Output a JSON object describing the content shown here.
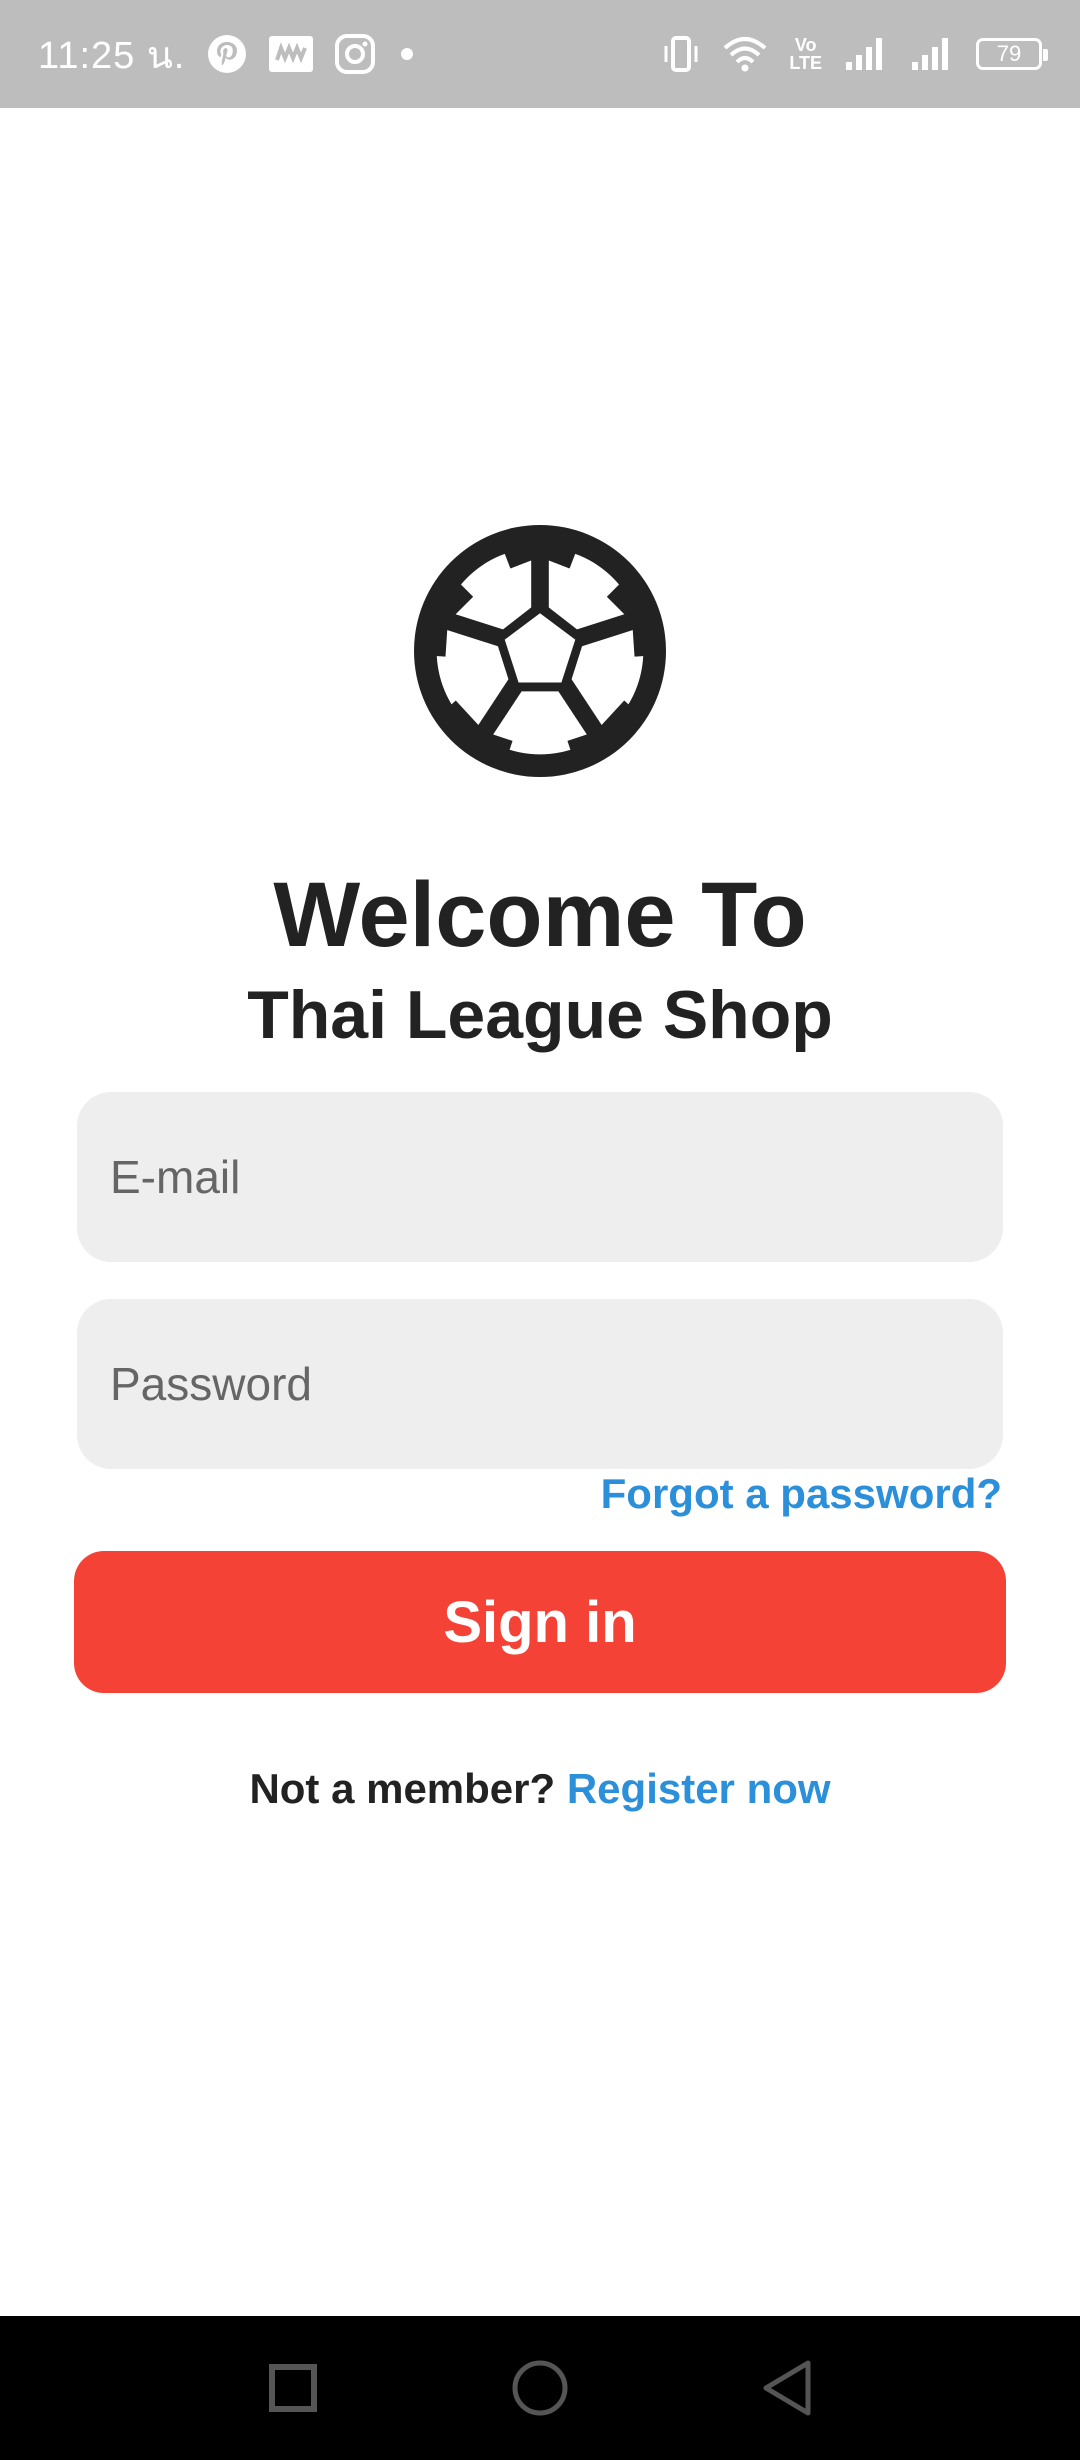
{
  "status_bar": {
    "time": "11:25 น.",
    "notification_icons": [
      "pinterest-icon",
      "news-icon",
      "instagram-icon",
      "dot-icon"
    ],
    "status_icons": [
      "vibrate-icon",
      "wifi-icon",
      "volte-icon",
      "signal-icon",
      "signal-icon",
      "battery-icon"
    ],
    "volte_label_top": "Vo",
    "volte_label_bottom": "LTE",
    "battery_level": "79"
  },
  "logo": {
    "icon": "soccer-ball-icon"
  },
  "welcome": {
    "title": "Welcome To",
    "subtitle": "Thai League Shop"
  },
  "form": {
    "email_placeholder": "E-mail",
    "email_value": "",
    "password_placeholder": "Password",
    "password_value": "",
    "forgot_password_label": "Forgot a password?",
    "sign_in_label": "Sign in"
  },
  "register": {
    "prompt": "Not a member?",
    "link_label": "Register now"
  },
  "nav_bar": {
    "buttons": [
      "recents-square-icon",
      "home-circle-icon",
      "back-triangle-icon"
    ]
  },
  "colors": {
    "status_bar_bg": "#bdbdbd",
    "input_bg": "#eeeeee",
    "primary_button": "#f44336",
    "link": "#2b8fd9",
    "text_dark": "#222222",
    "nav_bar_bg": "#000000"
  }
}
